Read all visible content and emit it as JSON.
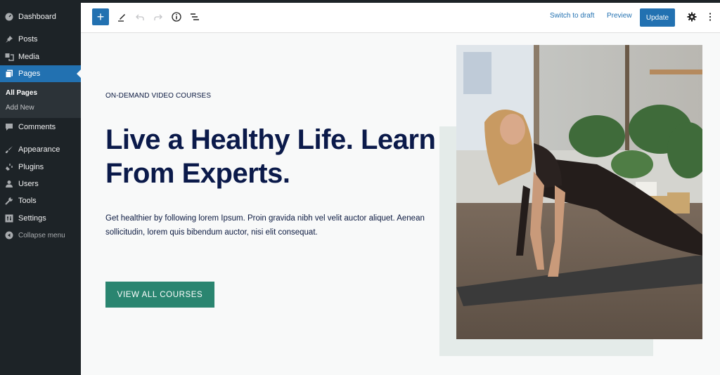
{
  "sidebar": {
    "items": [
      {
        "label": "Dashboard",
        "icon": "dashboard-icon"
      },
      {
        "label": "Posts",
        "icon": "pin-icon"
      },
      {
        "label": "Media",
        "icon": "media-icon"
      },
      {
        "label": "Pages",
        "icon": "pages-icon",
        "active": true
      },
      {
        "label": "Comments",
        "icon": "comment-icon"
      },
      {
        "label": "Appearance",
        "icon": "paintbrush-icon"
      },
      {
        "label": "Plugins",
        "icon": "plugin-icon"
      },
      {
        "label": "Users",
        "icon": "user-icon"
      },
      {
        "label": "Tools",
        "icon": "wrench-icon"
      },
      {
        "label": "Settings",
        "icon": "settings-icon"
      }
    ],
    "submenu": [
      {
        "label": "All Pages",
        "current": true
      },
      {
        "label": "Add New"
      }
    ],
    "collapse_label": "Collapse menu"
  },
  "toolbar": {
    "add_label": "+",
    "switch_to_draft": "Switch to draft",
    "preview": "Preview",
    "update": "Update"
  },
  "content": {
    "eyebrow": "ON-DEMAND VIDEO COURSES",
    "headline": "Live a Healthy Life. Learn From Experts.",
    "body": "Get healthier by following lorem Ipsum. Proin gravida nibh vel velit auctor aliquet. Aenean sollicitudin, lorem quis bibendum auctor, nisi elit consequat.",
    "cta": "VIEW ALL COURSES",
    "image_alt": "Woman doing yoga plank pose on a mat in a bright room with plants"
  },
  "colors": {
    "accent": "#2271b1",
    "sidebar_bg": "#1d2327",
    "heading": "#0b1a4a",
    "cta_bg": "#2a8570",
    "backdrop": "#e4ebe9"
  }
}
